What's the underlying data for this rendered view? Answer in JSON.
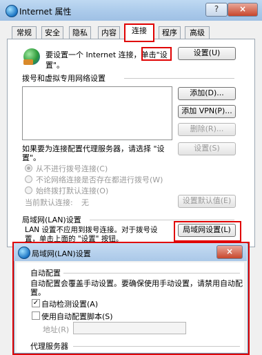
{
  "window": {
    "title": "Internet 属性",
    "caption_help": "?",
    "caption_close": "×"
  },
  "tabs": [
    {
      "label": "常规"
    },
    {
      "label": "安全"
    },
    {
      "label": "隐私"
    },
    {
      "label": "内容"
    },
    {
      "label": "连接",
      "active": true
    },
    {
      "label": "程序"
    },
    {
      "label": "高级"
    }
  ],
  "connections": {
    "setup_text_line1": "要设置一个 Internet 连接，单击\"设",
    "setup_text_line2": "置\"。",
    "setup_button": "设置(U)",
    "dialup_group": "拨号和虚拟专用网络设置",
    "add_button": "添加(D)...",
    "add_vpn_button": "添加 VPN(P)...",
    "delete_button": "删除(R)...",
    "proxy_text_line1": "如果要为连接配置代理服务器，请选择 \"设",
    "proxy_text_line2": "置\"。",
    "settings_button": "设置(S)",
    "radio_never": "从不进行拨号连接(C)",
    "radio_when_none": "不论网络连接是否存在都进行拨号(W)",
    "radio_always": "始终拨打默认连接(O)",
    "current_default_label": "当前默认连接:",
    "current_default_value": "无",
    "set_default_button": "设置默认值(E)",
    "lan_group": "局域网(LAN)设置",
    "lan_text_line1": "LAN 设置不应用到拨号连接。对于拨号设",
    "lan_text_line2": "置，单击上面的 \"设置\" 按钮。",
    "lan_button": "局域网设置(L)"
  },
  "lan_dialog": {
    "title": "局域网(LAN)设置",
    "close": "×",
    "auto_config_group": "自动配置",
    "auto_config_desc_line1": "自动配置会覆盖手动设置。要确保使用手动设置，请禁用自动配",
    "auto_config_desc_line2": "置。",
    "auto_detect_label": "自动检测设置(A)",
    "auto_detect_checked": true,
    "use_script_label": "使用自动配置脚本(S)",
    "use_script_checked": false,
    "address_label": "地址(R)",
    "address_value": "",
    "proxy_group": "代理服务器"
  },
  "colors": {
    "highlight": "#e00000",
    "title_gradient_top": "#bfd9f2",
    "disabled_text": "#9a9a9a"
  }
}
